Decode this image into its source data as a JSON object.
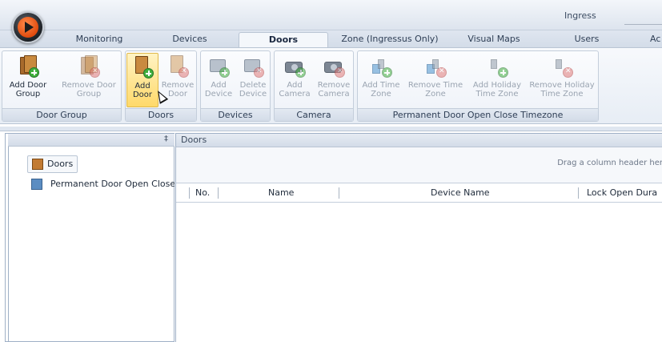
{
  "window": {
    "title": "Ingress"
  },
  "tabs": [
    {
      "label": "Monitoring"
    },
    {
      "label": "Devices"
    },
    {
      "label": "Doors"
    },
    {
      "label": "Zone (Ingressus Only)"
    },
    {
      "label": "Visual Maps"
    },
    {
      "label": "Users"
    },
    {
      "label": "Ac"
    }
  ],
  "ribbon": {
    "groups": [
      {
        "label": "Door Group",
        "buttons": [
          {
            "label": "Add Door\nGroup",
            "icon": "add-door-group-icon",
            "enabled": true
          },
          {
            "label": "Remove Door\nGroup",
            "icon": "remove-door-group-icon",
            "enabled": false
          }
        ]
      },
      {
        "label": "Doors",
        "buttons": [
          {
            "label": "Add\nDoor",
            "icon": "add-door-icon",
            "enabled": true
          },
          {
            "label": "Remove\nDoor",
            "icon": "remove-door-icon",
            "enabled": false
          }
        ]
      },
      {
        "label": "Devices",
        "buttons": [
          {
            "label": "Add\nDevice",
            "icon": "add-device-icon",
            "enabled": false
          },
          {
            "label": "Delete\nDevice",
            "icon": "delete-device-icon",
            "enabled": false
          }
        ]
      },
      {
        "label": "Camera",
        "buttons": [
          {
            "label": "Add\nCamera",
            "icon": "add-camera-icon",
            "enabled": false
          },
          {
            "label": "Remove\nCamera",
            "icon": "remove-camera-icon",
            "enabled": false
          }
        ]
      },
      {
        "label": "Permanent Door Open Close Timezone",
        "buttons": [
          {
            "label": "Add Time\nZone",
            "icon": "add-time-zone-icon",
            "enabled": false
          },
          {
            "label": "Remove Time\nZone",
            "icon": "remove-time-zone-icon",
            "enabled": false
          },
          {
            "label": "Add Holiday\nTime Zone",
            "icon": "add-holiday-time-zone-icon",
            "enabled": false
          },
          {
            "label": "Remove Holiday\nTime Zone",
            "icon": "remove-holiday-time-zone-icon",
            "enabled": false
          }
        ]
      }
    ]
  },
  "left_panel": {
    "items": [
      {
        "label": "Doors",
        "icon": "door-icon"
      },
      {
        "label": "Permanent Door Open Close",
        "icon": "permanent-door-icon"
      }
    ]
  },
  "right_panel": {
    "header": "Doors",
    "group_hint": "Drag a column header her",
    "columns": [
      "No.",
      "Name",
      "Device Name",
      "Lock Open Dura"
    ]
  },
  "colors": {
    "accent": "#e24b0e",
    "ribbon_hover": "#ffd96a",
    "border": "#9fb0c6"
  }
}
